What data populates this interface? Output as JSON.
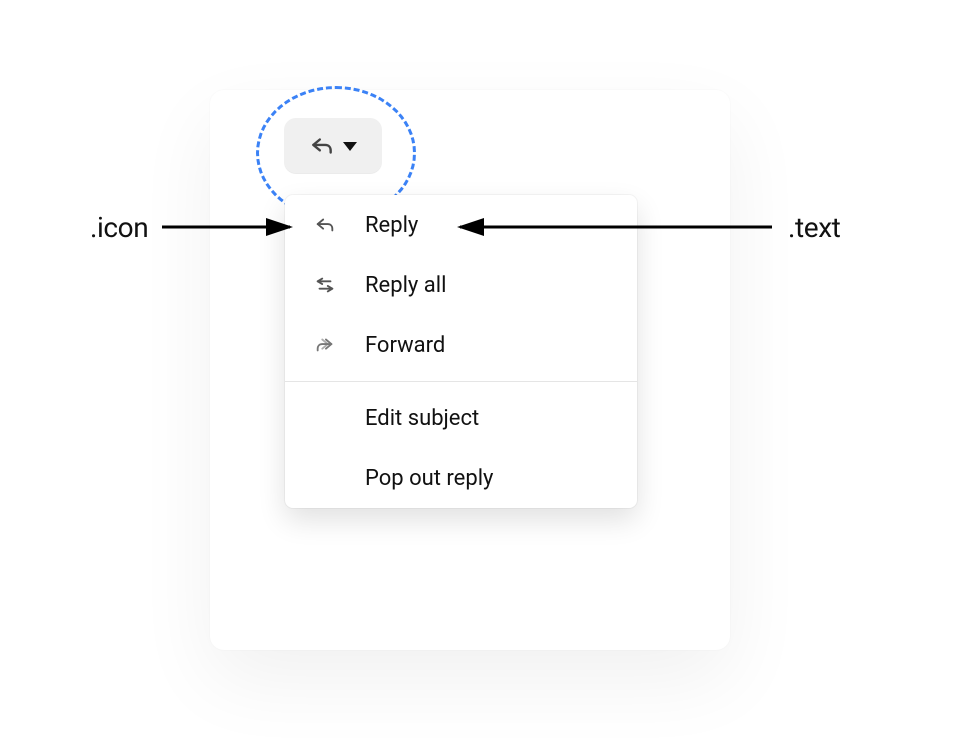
{
  "annotations": {
    "icon_label": ".icon",
    "text_label": ".text"
  },
  "button": {
    "icon_name": "reply-arrow",
    "caret_name": "dropdown-caret"
  },
  "menu": {
    "items": [
      {
        "icon": "reply-icon",
        "label": "Reply"
      },
      {
        "icon": "reply-all-icon",
        "label": "Reply all"
      },
      {
        "icon": "forward-icon",
        "label": "Forward"
      }
    ],
    "items2": [
      {
        "label": "Edit subject"
      },
      {
        "label": "Pop out reply"
      }
    ]
  }
}
